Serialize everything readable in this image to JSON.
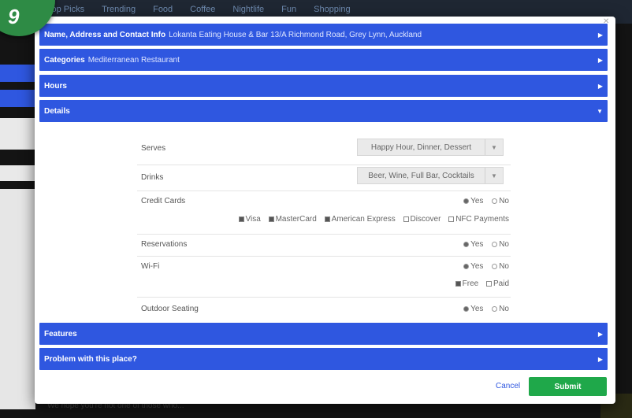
{
  "background": {
    "nav_items": [
      "Top Picks",
      "Trending",
      "Food",
      "Coffee",
      "Nightlife",
      "Fun",
      "Shopping"
    ],
    "bottom_text": "We hope you're not one of those who..."
  },
  "badge": {
    "number": "9"
  },
  "accordion": {
    "name_title": "Name, Address and Contact Info",
    "name_value": "Lokanta Eating House & Bar 13/A Richmond Road, Grey Lynn, Auckland",
    "categories_title": "Categories",
    "categories_value": "Mediterranean Restaurant",
    "hours_title": "Hours",
    "details_title": "Details",
    "features_title": "Features",
    "problem_title": "Problem with this place?"
  },
  "details": {
    "serves": {
      "label": "Serves",
      "value": "Happy Hour, Dinner, Dessert"
    },
    "drinks": {
      "label": "Drinks",
      "value": "Beer, Wine, Full Bar, Cocktails"
    },
    "credit_cards": {
      "label": "Credit Cards",
      "yes": "Yes",
      "no": "No",
      "selected": "Yes",
      "options": [
        {
          "label": "Visa",
          "checked": true
        },
        {
          "label": "MasterCard",
          "checked": true
        },
        {
          "label": "American Express",
          "checked": true
        },
        {
          "label": "Discover",
          "checked": false
        },
        {
          "label": "NFC Payments",
          "checked": false
        }
      ]
    },
    "reservations": {
      "label": "Reservations",
      "yes": "Yes",
      "no": "No",
      "selected": "Yes"
    },
    "wifi": {
      "label": "Wi-Fi",
      "yes": "Yes",
      "no": "No",
      "selected": "Yes",
      "options": [
        {
          "label": "Free",
          "checked": true
        },
        {
          "label": "Paid",
          "checked": false
        }
      ]
    },
    "outdoor_seating": {
      "label": "Outdoor Seating",
      "yes": "Yes",
      "no": "No",
      "selected": "Yes"
    }
  },
  "footer": {
    "cancel": "Cancel",
    "submit": "Submit"
  },
  "colors": {
    "accordion_blue": "#2f57e0",
    "submit_green": "#1fa84a",
    "badge_green": "#2e8b45"
  }
}
